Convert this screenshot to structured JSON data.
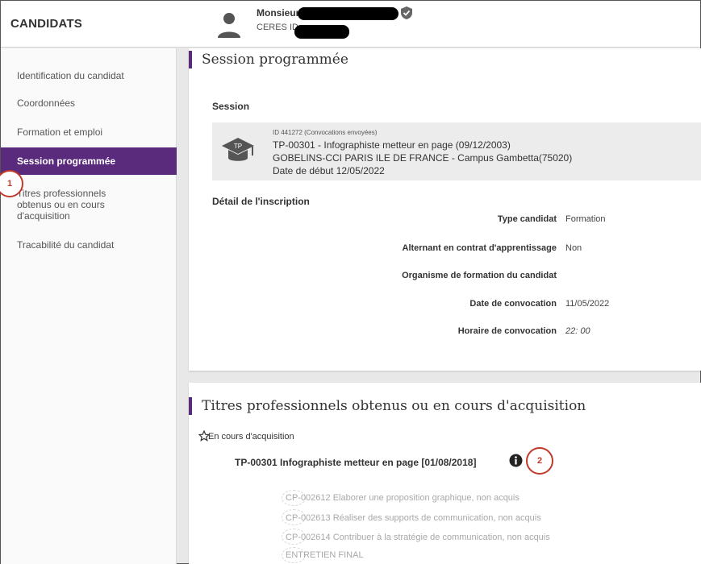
{
  "header": {
    "brand": "CANDIDATS",
    "user_name": "Monsieur",
    "user_id_label": "CERES ID"
  },
  "sidebar": {
    "items": [
      {
        "label": "Identification du candidat"
      },
      {
        "label": "Coordonnées"
      },
      {
        "label": "Formation et emploi"
      },
      {
        "label": "Session programmée"
      },
      {
        "label": "Titres professionnels obtenus ou en cours d'acquisition"
      },
      {
        "label": "Tracabilité du candidat"
      }
    ],
    "active_index": 3
  },
  "annotations": {
    "badge1": "1",
    "badge2": "2"
  },
  "session": {
    "title": "Session programmée",
    "subtitle": "Session",
    "id_line": "ID 441272 (Convocations envoyées)",
    "title_line": "TP-00301 - Infographiste metteur en page (09/12/2003)",
    "place_line": "GOBELINS-CCI PARIS ILE DE FRANCE - Campus Gambetta(75020)",
    "date_line": "Date de début 12/05/2022",
    "tp_icon_text": "TP"
  },
  "inscription": {
    "title": "Détail de l'inscription",
    "rows": [
      {
        "label": "Type candidat",
        "value": "Formation"
      },
      {
        "label": "Alternant en contrat d'apprentissage",
        "value": "Non"
      },
      {
        "label": "Organisme de formation du candidat",
        "value": ""
      },
      {
        "label": "Date de convocation",
        "value": "11/05/2022"
      },
      {
        "label": "Horaire de convocation",
        "value": "22: 00"
      }
    ]
  },
  "titres": {
    "title": "Titres professionnels obtenus ou en cours d'acquisition",
    "status_label": "En cours d'acquisition",
    "tp_title": "TP-00301 Infographiste metteur en page [01/08/2018]",
    "competences": [
      "CP-002612 Elaborer une proposition graphique, non acquis",
      "CP-002613 Réaliser des supports de communication, non acquis",
      "CP-002614 Contribuer à la stratégie de communication, non acquis",
      "ENTRETIEN FINAL"
    ]
  },
  "colors": {
    "accent": "#5a2b7c",
    "annotation": "#c0392b"
  }
}
